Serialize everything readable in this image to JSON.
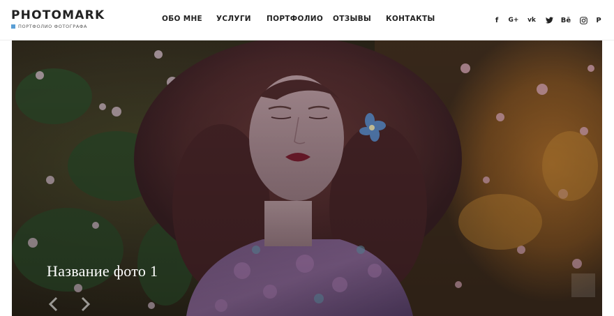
{
  "header": {
    "logo": {
      "title": "PHOTOMARK",
      "subtitle": "ПОРТФОЛИО ФОТОГРАФА"
    },
    "nav": [
      {
        "label": "ОБО МНЕ"
      },
      {
        "label": "УСЛУГИ"
      },
      {
        "label": "ПОРТФОЛИО"
      },
      {
        "label": "ОТЗЫВЫ"
      },
      {
        "label": "КОНТАКТЫ"
      }
    ],
    "social": [
      {
        "icon": "facebook-icon",
        "glyph": "f"
      },
      {
        "icon": "google-plus-icon",
        "glyph": "G+"
      },
      {
        "icon": "vk-icon",
        "glyph": "vk"
      },
      {
        "icon": "twitter-icon",
        "glyph": ""
      },
      {
        "icon": "behance-icon",
        "glyph": "Bē"
      },
      {
        "icon": "instagram-icon",
        "glyph": ""
      },
      {
        "icon": "pinterest-icon",
        "glyph": "P"
      }
    ]
  },
  "slider": {
    "caption": "Название фото 1",
    "photo": "portrait-woman-curly-hair-flowers"
  },
  "colors": {
    "logo_accent": "#5a9fd6",
    "text_dark": "#222222"
  }
}
